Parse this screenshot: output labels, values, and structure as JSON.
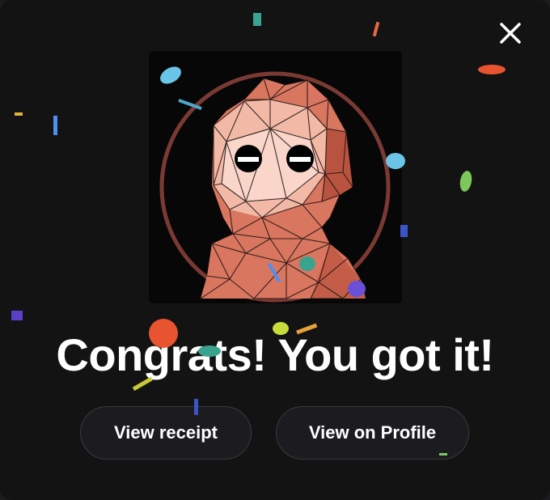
{
  "dialog": {
    "headline": "Congrats! You got it!",
    "close_icon": "close-icon",
    "artwork_icon": "low-poly-avatar-nft"
  },
  "actions": {
    "view_receipt_label": "View receipt",
    "view_profile_label": "View on Profile"
  },
  "colors": {
    "background": "#131314",
    "button_background": "#1c1c20",
    "button_border": "#3a3a3f",
    "text": "#ffffff",
    "artwork_ring": "#7a3a33",
    "avatar_fill": "#e07a66"
  }
}
